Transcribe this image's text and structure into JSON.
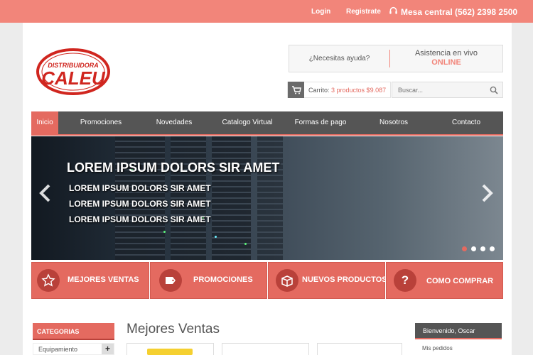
{
  "topbar": {
    "login": "Login",
    "register": "Registrate",
    "phone": "Mesa central (562) 2398 2500"
  },
  "logo": {
    "small_text": "DISTRIBUIDORA",
    "big_text": "CALEU"
  },
  "help": {
    "question": "¿Necesitas ayuda?",
    "live_label": "Asistencia en vivo",
    "live_status": "ONLINE"
  },
  "cart": {
    "label": "Carrito:",
    "summary": "3 productos $9.087"
  },
  "search": {
    "placeholder": "Buscar..."
  },
  "nav": {
    "items": [
      {
        "label": "Inicio",
        "active": true
      },
      {
        "label": "Promociones"
      },
      {
        "label": "Novedades"
      },
      {
        "label": "Catalogo Virtual"
      },
      {
        "label": "Formas de pago"
      },
      {
        "label": "Nosotros"
      },
      {
        "label": "Contacto"
      }
    ]
  },
  "slider": {
    "title": "LOREM IPSUM DOLORS SIR AMET",
    "lines": [
      "LOREM IPSUM DOLORS SIR AMET",
      "LOREM IPSUM DOLORS SIR AMET",
      "LOREM IPSUM DOLORS SIR AMET"
    ],
    "current_slide": 1,
    "total_slides": 4
  },
  "categories": [
    {
      "label": "MEJORES VENTAS",
      "icon": "star-icon"
    },
    {
      "label": "PROMOCIONES",
      "icon": "tag-icon"
    },
    {
      "label": "NUEVOS PRODUCTOS",
      "icon": "box-icon"
    },
    {
      "label": "COMO COMPRAR",
      "icon": "question-icon"
    }
  ],
  "sidebar": {
    "heading": "CATEGORIAS",
    "items": [
      {
        "label": "Equipamiento"
      }
    ]
  },
  "main": {
    "section_title": "Mejores Ventas"
  },
  "account": {
    "welcome": "Bienvenido, Oscar",
    "items": [
      {
        "label": "Mis pedidos"
      }
    ]
  },
  "colors": {
    "accent": "#e46a60",
    "topbar": "#f2857a",
    "nav": "#555555",
    "page_bg": "#ececec"
  }
}
